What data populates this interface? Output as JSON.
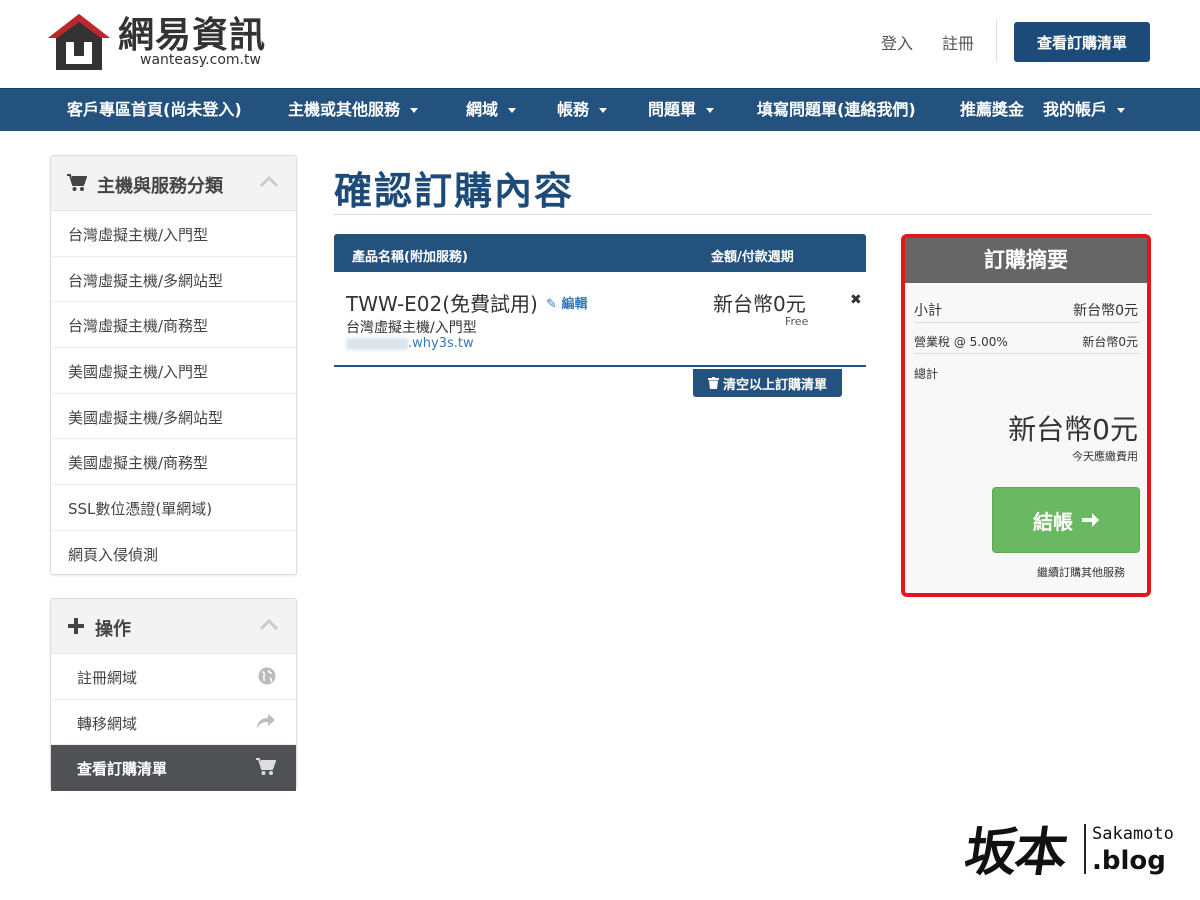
{
  "header": {
    "logo_text": "網易資訊",
    "logo_sub": "wanteasy.com.tw",
    "login": "登入",
    "register": "註冊",
    "view_cart": "查看訂購清單"
  },
  "nav": [
    {
      "label": "客戶專區首頁(尚未登入)"
    },
    {
      "label": "主機或其他服務"
    },
    {
      "label": "網域"
    },
    {
      "label": "帳務"
    },
    {
      "label": "問題單"
    },
    {
      "label": "填寫問題單(連絡我們)"
    },
    {
      "label": "推薦獎金"
    },
    {
      "label": "我的帳戶"
    }
  ],
  "sidebar": {
    "categories_title": "主機與服務分類",
    "categories": [
      "台灣虛擬主機/入門型",
      "台灣虛擬主機/多網站型",
      "台灣虛擬主機/商務型",
      "美國虛擬主機/入門型",
      "美國虛擬主機/多網站型",
      "美國虛擬主機/商務型",
      "SSL數位憑證(單網域)",
      "網頁入侵偵測"
    ],
    "actions_title": "操作",
    "actions": [
      {
        "label": "註冊網域",
        "icon": "globe-icon"
      },
      {
        "label": "轉移網域",
        "icon": "share-arrow-icon"
      },
      {
        "label": "查看訂購清單",
        "icon": "cart-icon",
        "active": true
      }
    ]
  },
  "main": {
    "title": "確認訂購內容",
    "table_headers": {
      "product": "產品名稱(附加服務)",
      "price": "金額/付款週期"
    },
    "item": {
      "name": "TWW-E02(免費試用)",
      "edit": "編輯",
      "group": "台灣虛擬主機/入門型",
      "domain": ".why3s.tw",
      "price": "新台幣0元",
      "cycle": "Free"
    },
    "empty_cart": "清空以上訂購清單"
  },
  "summary": {
    "title": "訂購摘要",
    "subtotal_label": "小計",
    "subtotal_value": "新台幣0元",
    "tax_label": "營業稅 @ 5.00%",
    "tax_value": "新台幣0元",
    "total_label": "總計",
    "total_value": "新台幣0元",
    "due_today": "今天應繳費用",
    "checkout": "結帳",
    "continue": "繼續訂購其他服務"
  },
  "watermark": {
    "kanji": "坂本",
    "name": "Sakamoto",
    "blog": ".blog"
  },
  "colors": {
    "primary": "#24527f",
    "checkout": "#6bb862",
    "highlight": "#e8141b"
  }
}
